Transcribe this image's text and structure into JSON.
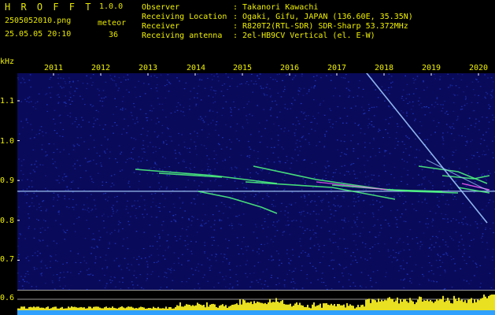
{
  "header": {
    "app_name": "H R O F F T",
    "version": "1.0.0",
    "filename": "2505052010.png",
    "datetime": "25.05.05 20:10",
    "count_label": "meteor",
    "count_value": "36"
  },
  "info": [
    {
      "label": "Observer",
      "value": ": Takanori Kawachi"
    },
    {
      "label": "Receiving Location",
      "value": ": Ogaki, Gifu, JAPAN (136.60E, 35.35N)"
    },
    {
      "label": "Receiver",
      "value": ": R820T2(RTL-SDR) SDR-Sharp 53.372MHz"
    },
    {
      "label": "Receiving antenna",
      "value": ": 2el-HB9CV Vertical (el. E-W)"
    }
  ],
  "chart_data": {
    "type": "heatmap",
    "ylabel": "kHz",
    "y_ticks": [
      "1.1",
      "1.0",
      "0.9",
      "0.8",
      "0.7",
      "0.6"
    ],
    "x_ticks": [
      "2011",
      "2012",
      "2013",
      "2014",
      "2015",
      "2016",
      "2017",
      "2018",
      "2019",
      "2020"
    ],
    "baseline_khz": 0.873,
    "colors": {
      "background": "#0a0a5a",
      "noise": "#1f3cc8",
      "baseline": "#aad4ff",
      "echo": "#50ff80",
      "echo_core": "#ff60ff",
      "tick_text": "#f0f000",
      "strip_fill": "#e8e020",
      "strip_base": "#30a0ff"
    }
  }
}
